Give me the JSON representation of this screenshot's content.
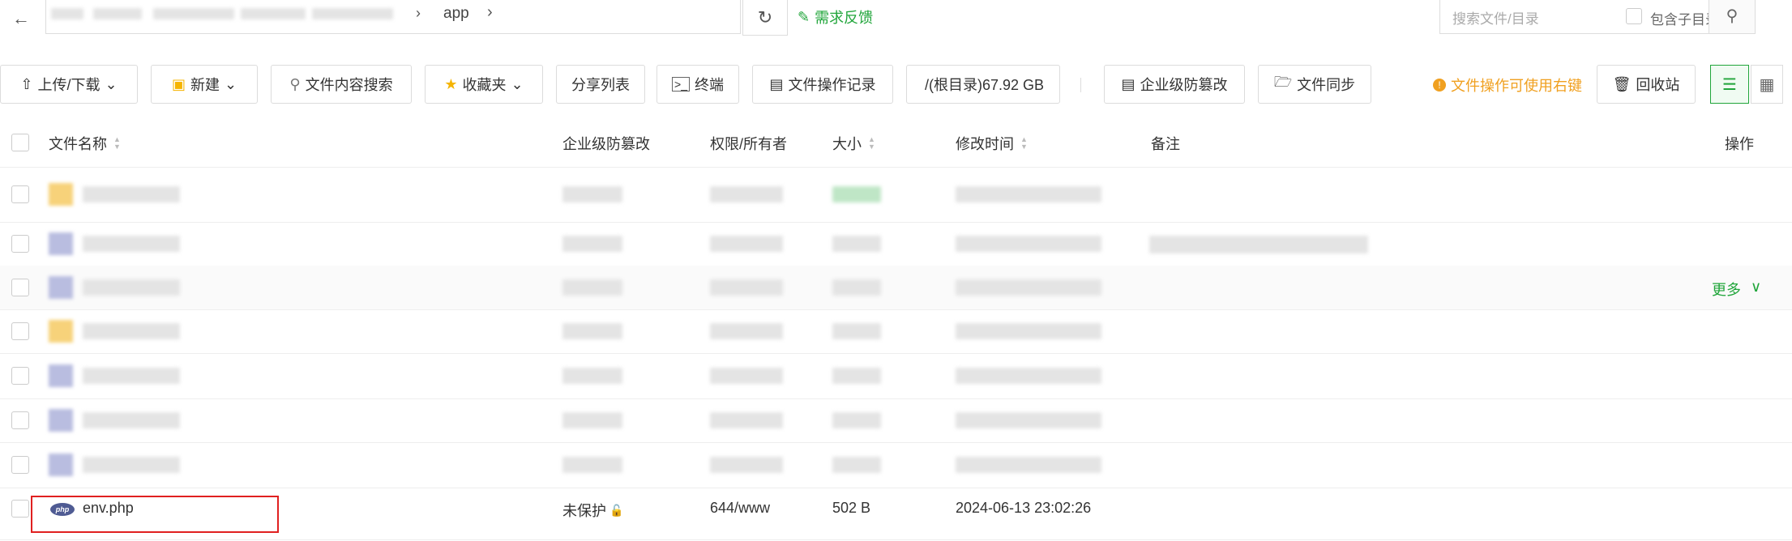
{
  "topbar": {
    "crumb": "app",
    "feedback": "需求反馈",
    "search_placeholder": "搜索文件/目录",
    "include_subdir": "包含子目录"
  },
  "toolbar": {
    "upload": "上传/下载",
    "new": "新建",
    "content_search": "文件内容搜索",
    "favorites": "收藏夹",
    "share_list": "分享列表",
    "terminal": "终端",
    "op_log": "文件操作记录",
    "root": "/(根目录)67.92 GB",
    "tamper": "企业级防篡改",
    "sync": "文件同步",
    "tip": "文件操作可使用右键",
    "recycle": "回收站"
  },
  "table": {
    "headers": {
      "name": "文件名称",
      "tamper": "企业级防篡改",
      "perm": "权限/所有者",
      "size": "大小",
      "mtime": "修改时间",
      "note": "备注",
      "action": "操作"
    },
    "more_label": "更多",
    "last_row": {
      "name": "env.php",
      "tamper": "未保护",
      "perm": "644/www",
      "size": "502 B",
      "mtime": "2024-06-13 23:02:26"
    }
  },
  "colors": {
    "accent": "#20a53a",
    "warning": "#f0a020",
    "highlight": "#e02020"
  }
}
